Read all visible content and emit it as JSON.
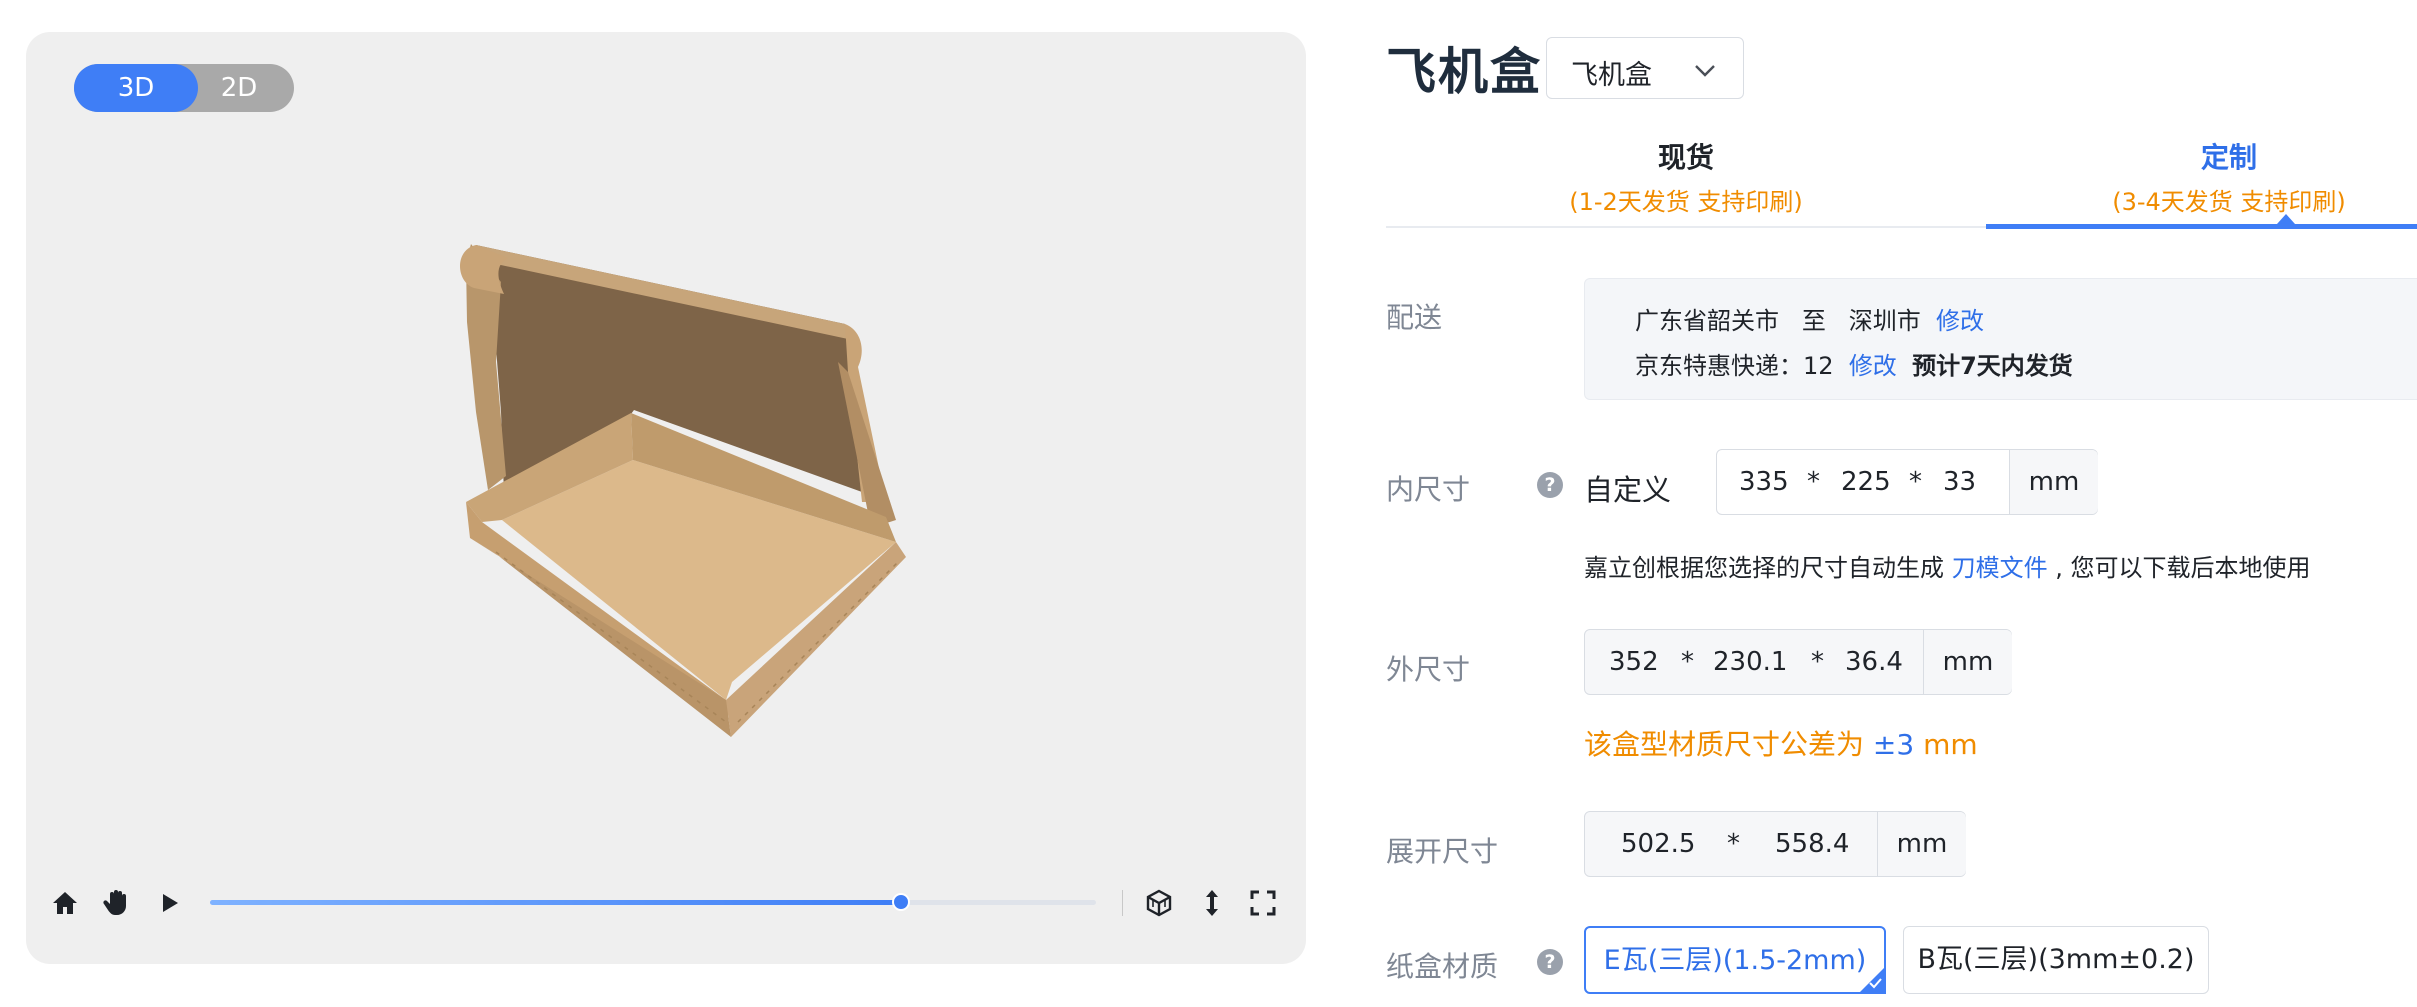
{
  "viewer": {
    "view_modes": [
      "3D",
      "2D"
    ],
    "active_view": "3D",
    "timeline_progress_percent": 78,
    "icons": [
      "home-icon",
      "pan-hand-icon",
      "play-icon",
      "cube-icon",
      "vertical-arrows-icon",
      "fullscreen-icon"
    ]
  },
  "product": {
    "title": "飞机盒",
    "select_value": "飞机盒"
  },
  "tabs": [
    {
      "title": "现货",
      "subtitle": "(1-2天发货 支持印刷)"
    },
    {
      "title": "定制",
      "subtitle": "(3-4天发货 支持印刷)"
    }
  ],
  "active_tab": "定制",
  "delivery": {
    "label": "配送",
    "from": "广东省韶关市",
    "to_word": "至",
    "to": "深圳市",
    "change1": "修改",
    "courier": "京东特惠快递：12",
    "change2": "修改",
    "eta": "预计7天内发货"
  },
  "inner": {
    "label": "内尺寸",
    "mode": "自定义",
    "l": "335",
    "w": "225",
    "h": "33",
    "sep": "*",
    "unit": "mm",
    "note_prefix": "嘉立创根据您选择的尺寸自动生成",
    "note_link": "刀模文件",
    "note_suffix": ", 您可以下载后本地使用"
  },
  "outer": {
    "label": "外尺寸",
    "l": "352",
    "w": "230.1",
    "h": "36.4",
    "sep": "*",
    "unit": "mm",
    "tolerance_prefix": "该盒型材质尺寸公差为",
    "tolerance_value": "±3",
    "tolerance_unit": "mm"
  },
  "unfold": {
    "label": "展开尺寸",
    "l": "502.5",
    "w": "558.4",
    "sep": "*",
    "unit": "mm"
  },
  "material": {
    "label": "纸盒材质",
    "options": [
      "E瓦(三层)(1.5-2mm)",
      "B瓦(三层)(3mm±0.2)"
    ],
    "selected": "E瓦(三层)(1.5-2mm)"
  },
  "colors": {
    "accent": "#3f7ef6",
    "link": "#2f6fe8",
    "warning": "#f08c00",
    "cardboard": "#d9b88a"
  }
}
